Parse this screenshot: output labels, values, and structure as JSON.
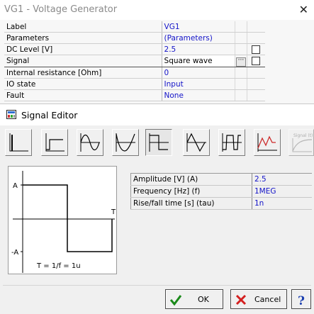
{
  "vg_window": {
    "title": "VG1 - Voltage Generator",
    "close_glyph": "✕",
    "properties": [
      {
        "name": "Label",
        "value": "VG1",
        "selected": false
      },
      {
        "name": "Parameters",
        "value": "(Parameters)",
        "selected": false
      },
      {
        "name": "DC Level [V]",
        "value": "2.5",
        "selected": false,
        "checkbox": true
      },
      {
        "name": "Signal",
        "value": "Square wave",
        "selected": true,
        "ellipsis": "···",
        "checkbox": true
      },
      {
        "name": "Internal resistance [Ohm]",
        "value": "0",
        "selected": false
      },
      {
        "name": "IO state",
        "value": "Input",
        "selected": false
      },
      {
        "name": "Fault",
        "value": "None",
        "selected": false
      }
    ]
  },
  "signal_editor": {
    "title": "Signal Editor",
    "icon": "signal-editor-icon",
    "waveform_buttons": [
      {
        "name": "impulse-wave-icon",
        "pressed": false
      },
      {
        "name": "unit-step-icon",
        "pressed": false
      },
      {
        "name": "sine-wave-icon",
        "pressed": false
      },
      {
        "name": "full-wave-sine-icon",
        "pressed": false
      },
      {
        "name": "square-wave-icon",
        "pressed": true
      },
      {
        "name": "triangle-wave-icon",
        "pressed": false
      },
      {
        "name": "pulse-train-icon",
        "pressed": false
      },
      {
        "name": "piecewise-linear-icon",
        "pressed": false
      },
      {
        "name": "signal-function-icon",
        "pressed": false,
        "label": "Signal (t)",
        "disabled": true
      }
    ],
    "preview": {
      "amp_label": "A",
      "neg_amp_label": "-A",
      "period_label": "T",
      "formula": "T = 1/f = 1u"
    },
    "parameters": [
      {
        "name": "Amplitude [V] (A)",
        "value": "2.5"
      },
      {
        "name": "Frequency [Hz] (f)",
        "value": "1MEG"
      },
      {
        "name": "Rise/fall time [s] (tau)",
        "value": "1n"
      }
    ],
    "buttons": {
      "ok": "OK",
      "cancel": "Cancel",
      "help_icon": "help-icon"
    }
  }
}
